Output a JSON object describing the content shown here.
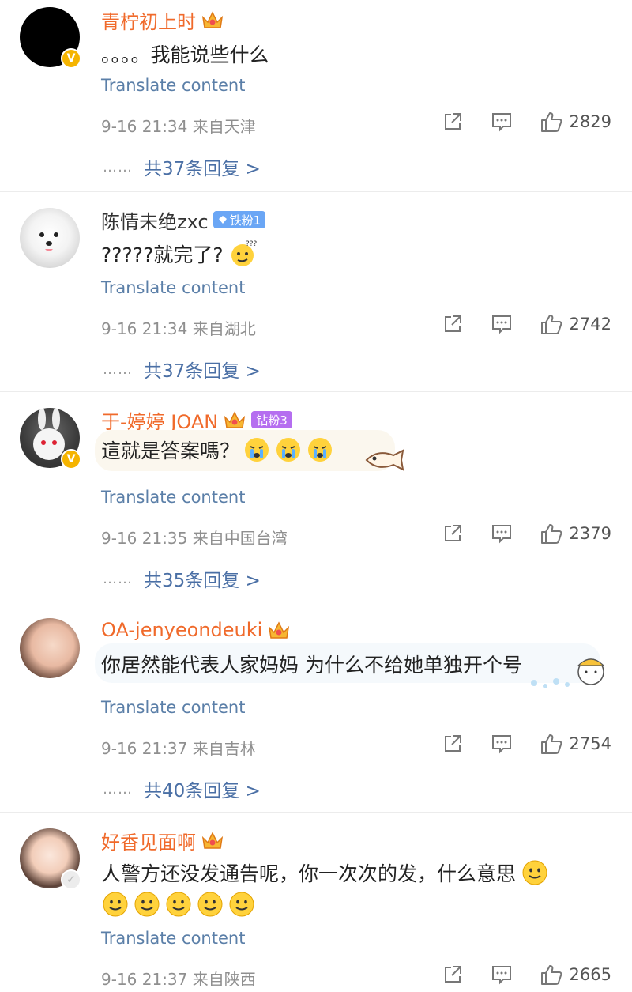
{
  "comments": [
    {
      "name": "青柠初上时",
      "text": "。。。。我能说些什么",
      "translate": "Translate content",
      "meta": "9-16 21:34  来自天津",
      "likes": "2829",
      "replies": "共37条回复 >",
      "dots": "……"
    },
    {
      "name": "陈情未绝zxc",
      "badge": "铁粉1",
      "text": "?????就完了?",
      "translate": "Translate content",
      "meta": "9-16 21:34  来自湖北",
      "likes": "2742",
      "replies": "共37条回复 >",
      "dots": "……"
    },
    {
      "name": "于-婷婷 JOAN",
      "badge": "钻粉3",
      "text": "這就是答案嗎？",
      "translate": "Translate content",
      "meta": "9-16 21:35  来自中国台湾",
      "likes": "2379",
      "replies": "共35条回复 >",
      "dots": "……"
    },
    {
      "name": "OA-jenyeondeuki",
      "text": "你居然能代表人家妈妈 为什么不给她单独开个号",
      "translate": "Translate content",
      "meta": "9-16 21:37  来自吉林",
      "likes": "2754",
      "replies": "共40条回复 >",
      "dots": "……"
    },
    {
      "name": "好香见面啊",
      "text": "人警方还没发通告呢，你一次次的发，什么意思",
      "translate": "Translate content",
      "meta": "9-16 21:37  来自陕西",
      "likes": "2665"
    }
  ],
  "icons": {
    "share": "share-icon",
    "comment": "comment-icon",
    "like": "thumbs-up-icon",
    "crown": "crown-icon",
    "verified": "verified-icon"
  },
  "colors": {
    "name_highlight": "#f06a2b",
    "translate_link": "#5b7fa8",
    "reply_link": "#4a6fa5",
    "meta_gray": "#8f8f8f"
  }
}
